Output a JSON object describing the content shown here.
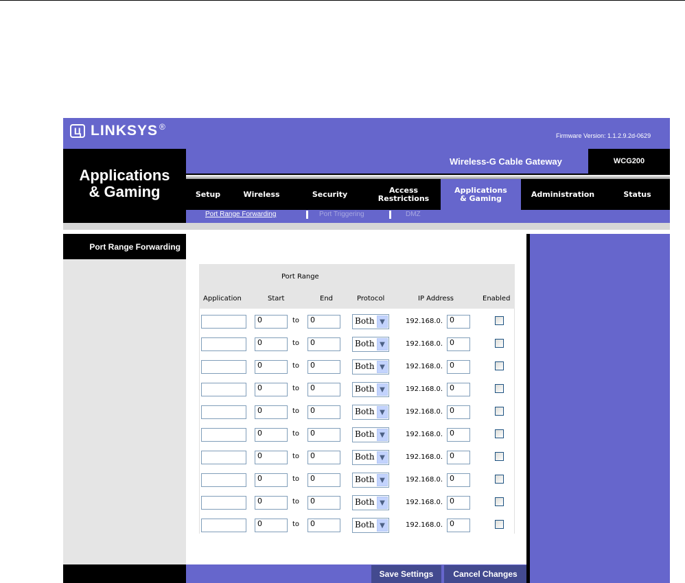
{
  "brand": {
    "logo_text": "LINKSYS",
    "logo_glyph": "Ц",
    "registered": "®"
  },
  "firmware": "Firmware Version: 1.1.2.9.2d-0629",
  "section_title": [
    "Applications",
    "& Gaming"
  ],
  "product_name": "Wireless-G Cable Gateway",
  "model": "WCG200",
  "tabs": [
    {
      "label": [
        "Setup"
      ]
    },
    {
      "label": [
        "Wireless"
      ]
    },
    {
      "label": [
        "Security"
      ]
    },
    {
      "label": [
        "Access",
        "Restrictions"
      ]
    },
    {
      "label": [
        "Applications",
        "& Gaming"
      ],
      "active": true
    },
    {
      "label": [
        "Administration"
      ]
    },
    {
      "label": [
        "Status"
      ]
    }
  ],
  "subnav": [
    "Port Range Forwarding",
    "Port Triggering",
    "DMZ"
  ],
  "left_label": "Port Range Forwarding",
  "table": {
    "group_header": "Port Range",
    "headers": {
      "application": "Application",
      "start": "Start",
      "end": "End",
      "protocol": "Protocol",
      "ip": "IP Address",
      "enabled": "Enabled"
    },
    "to_label": "to",
    "ip_prefix": "192.168.0.",
    "rows": [
      {
        "app": "",
        "start": "0",
        "end": "0",
        "protocol": "Both",
        "ip": "0",
        "enabled": false
      },
      {
        "app": "",
        "start": "0",
        "end": "0",
        "protocol": "Both",
        "ip": "0",
        "enabled": false
      },
      {
        "app": "",
        "start": "0",
        "end": "0",
        "protocol": "Both",
        "ip": "0",
        "enabled": false
      },
      {
        "app": "",
        "start": "0",
        "end": "0",
        "protocol": "Both",
        "ip": "0",
        "enabled": false
      },
      {
        "app": "",
        "start": "0",
        "end": "0",
        "protocol": "Both",
        "ip": "0",
        "enabled": false
      },
      {
        "app": "",
        "start": "0",
        "end": "0",
        "protocol": "Both",
        "ip": "0",
        "enabled": false
      },
      {
        "app": "",
        "start": "0",
        "end": "0",
        "protocol": "Both",
        "ip": "0",
        "enabled": false
      },
      {
        "app": "",
        "start": "0",
        "end": "0",
        "protocol": "Both",
        "ip": "0",
        "enabled": false
      },
      {
        "app": "",
        "start": "0",
        "end": "0",
        "protocol": "Both",
        "ip": "0",
        "enabled": false
      },
      {
        "app": "",
        "start": "0",
        "end": "0",
        "protocol": "Both",
        "ip": "0",
        "enabled": false
      }
    ]
  },
  "buttons": {
    "save": "Save Settings",
    "cancel": "Cancel Changes"
  },
  "colors": {
    "purple": "#6666cc",
    "black": "#000000",
    "gray": "#e5e5e5",
    "button": "#434a8f"
  },
  "icons": {
    "dropdown": "chevron-down-icon",
    "logo": "linksys-logo-icon"
  }
}
